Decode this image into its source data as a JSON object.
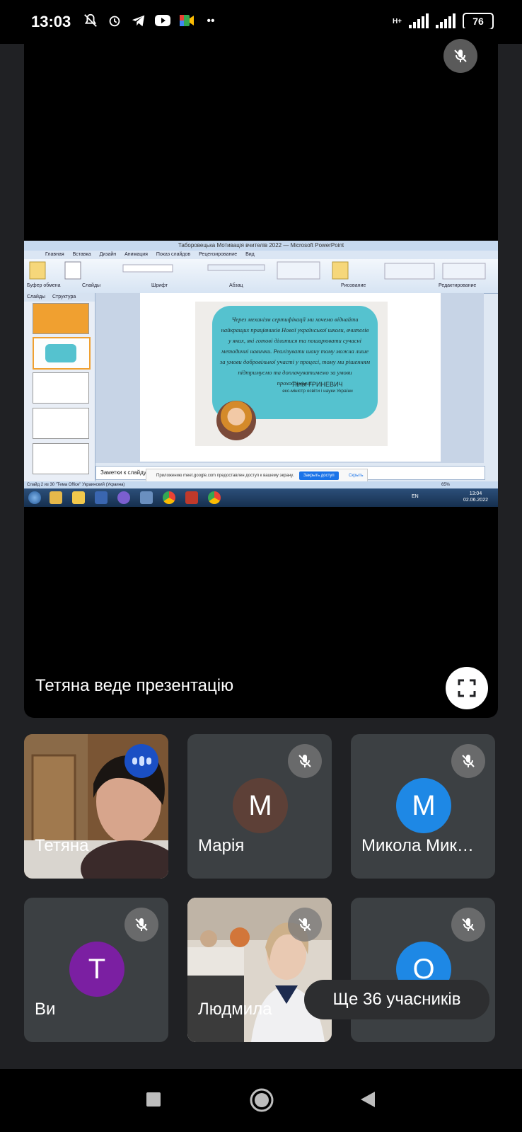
{
  "status_bar": {
    "time": "13:03",
    "icons": [
      "mute-bell-icon",
      "alarm-icon",
      "telegram-icon",
      "youtube-icon",
      "meet-icon",
      "more-dots-icon"
    ],
    "network": "H+",
    "battery": "76"
  },
  "main": {
    "presenter_text": "Тетяна веде презентацію",
    "screen": {
      "window_title": "Таборовецька Мотивація вчителів 2022 — Microsoft PowerPoint",
      "ribbon_tabs": [
        "Главная",
        "Вставка",
        "Дизайн",
        "Анимация",
        "Показ слайдов",
        "Рецензирование",
        "Вид"
      ],
      "ribbon_groups": [
        "Буфер обмена",
        "Слайды",
        "Шрифт",
        "Абзац",
        "Рисование",
        "Редактирование"
      ],
      "left_tabs": [
        "Слайды",
        "Структура"
      ],
      "quote": "Через механізм сертифікації ми хочемо віднайти найкращих працівників Нової української школи, вчителів у яких, які готові ділитися та поширювати сучасні методичні навички. Реалізувати шану тому можна лише за умови добровільної участі у процесі, тому ми рішенням підтримуємо та доплачуватимемо за умови проходження.",
      "signature_name": "Лілія ГРИНЕВИЧ",
      "signature_title": "екс-міністр освіти і науки України",
      "notes_label": "Заметки к слайду",
      "share_notice": "Приложению meet.google.com предоставлен доступ к вашему экрану.",
      "share_stop": "Закрыть доступ",
      "share_hide": "Скрыть",
      "status_text": "Слайд 2 из 30    \"Тема Office\"    Украинский (Украина)",
      "zoom": "65%",
      "tray_lang": "EN",
      "tray_time": "13:04",
      "tray_date": "02.06.2022"
    }
  },
  "participants": [
    {
      "name": "Тетяна",
      "initial": "",
      "color": "",
      "has_video": true,
      "speaking": true
    },
    {
      "name": "Марія",
      "initial": "М",
      "color": "#5d4037",
      "has_video": false
    },
    {
      "name": "Микола Мик…",
      "initial": "М",
      "color": "#1e88e5",
      "has_video": false
    },
    {
      "name": "Ви",
      "initial": "Т",
      "color": "#7b1fa2",
      "has_video": false
    },
    {
      "name": "Людмила",
      "initial": "",
      "color": "",
      "has_video": true
    },
    {
      "name": "",
      "initial": "О",
      "color": "#1e88e5",
      "has_video": false
    }
  ],
  "more_participants": "Ще 36 учасників",
  "colors": {
    "background": "#202124",
    "tile": "#3c4043",
    "accent": "#1a73e8"
  }
}
